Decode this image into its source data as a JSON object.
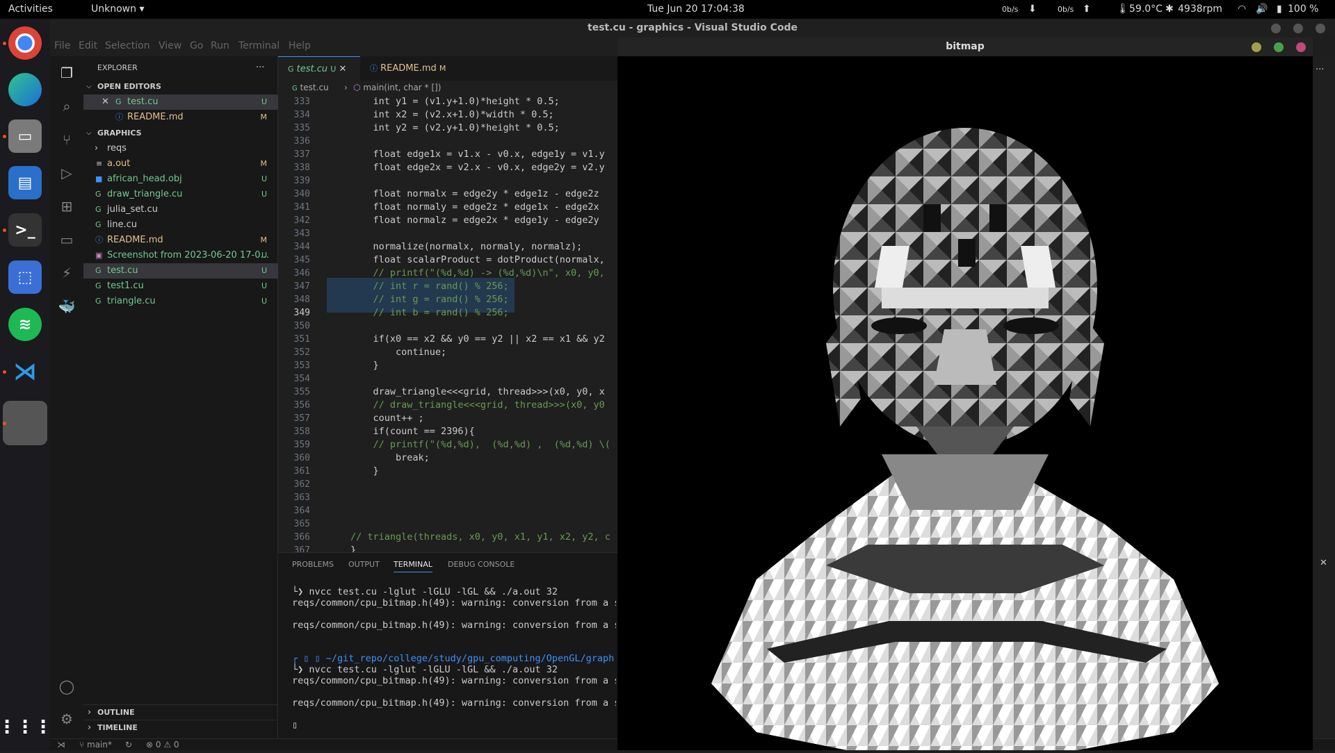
{
  "topbar": {
    "activities": "Activities",
    "app_menu": "Unknown",
    "clock": "Tue Jun 20  17:04:38",
    "net_down": "0b/s",
    "net_up": "0b/s",
    "temp": "59.0°C",
    "fan": "4938rpm",
    "battery": "100 %"
  },
  "vscode": {
    "title": "test.cu - graphics - Visual Studio Code",
    "menu": [
      "File",
      "Edit",
      "Selection",
      "View",
      "Go",
      "Run",
      "Terminal",
      "Help"
    ],
    "explorer": {
      "header": "EXPLORER",
      "open_editors_label": "OPEN EDITORS",
      "open_editors": [
        {
          "name": "test.cu",
          "status": "U"
        },
        {
          "name": "README.md",
          "status": "M"
        }
      ],
      "folder_label": "GRAPHICS",
      "files": [
        {
          "name": "reqs",
          "status": ""
        },
        {
          "name": "a.out",
          "status": "M"
        },
        {
          "name": "african_head.obj",
          "status": "U"
        },
        {
          "name": "draw_triangle.cu",
          "status": "U"
        },
        {
          "name": "julia_set.cu",
          "status": ""
        },
        {
          "name": "line.cu",
          "status": ""
        },
        {
          "name": "README.md",
          "status": "M"
        },
        {
          "name": "Screenshot from 2023-06-20 17-0...",
          "status": "U"
        },
        {
          "name": "test.cu",
          "status": "U"
        },
        {
          "name": "test1.cu",
          "status": "U"
        },
        {
          "name": "triangle.cu",
          "status": "U"
        }
      ],
      "outline_label": "OUTLINE",
      "timeline_label": "TIMELINE"
    },
    "tabs": [
      {
        "label": "test.cu",
        "status": "U"
      },
      {
        "label": "README.md",
        "status": "M"
      }
    ],
    "breadcrumb": {
      "file": "test.cu",
      "symbol": "main(int, char * [])"
    },
    "code_lines": [
      {
        "n": "333",
        "t": "    int y1 = (v1.y+1.0)*height * 0.5;"
      },
      {
        "n": "334",
        "t": "    int x2 = (v2.x+1.0)*width * 0.5;"
      },
      {
        "n": "335",
        "t": "    int y2 = (v2.y+1.0)*height * 0.5;"
      },
      {
        "n": "336",
        "t": ""
      },
      {
        "n": "337",
        "t": "    float edge1x = v1.x - v0.x, edge1y = v1.y"
      },
      {
        "n": "338",
        "t": "    float edge2x = v2.x - v0.x, edge2y = v2.y"
      },
      {
        "n": "339",
        "t": ""
      },
      {
        "n": "340",
        "t": "    float normalx = edge2y * edge1z - edge2z"
      },
      {
        "n": "341",
        "t": "    float normaly = edge2z * edge1x - edge2x"
      },
      {
        "n": "342",
        "t": "    float normalz = edge2x * edge1y - edge2y"
      },
      {
        "n": "343",
        "t": ""
      },
      {
        "n": "344",
        "t": "    normalize(normalx, normaly, normalz);"
      },
      {
        "n": "345",
        "t": "    float scalarProduct = dotProduct(normalx,"
      },
      {
        "n": "346",
        "t": "    // printf(\"(%d,%d) -> (%d,%d)\\n\", x0, y0,"
      },
      {
        "n": "347",
        "t": "    // int r = rand() % 256;"
      },
      {
        "n": "348",
        "t": "    // int g = rand() % 256;"
      },
      {
        "n": "349",
        "t": "    // int b = rand() % 256;"
      },
      {
        "n": "350",
        "t": ""
      },
      {
        "n": "351",
        "t": "    if(x0 == x2 && y0 == y2 || x2 == x1 && y2"
      },
      {
        "n": "352",
        "t": "        continue;"
      },
      {
        "n": "353",
        "t": "    }"
      },
      {
        "n": "354",
        "t": ""
      },
      {
        "n": "355",
        "t": "    draw_triangle<<<grid, thread>>>(x0, y0, x"
      },
      {
        "n": "356",
        "t": "    // draw_triangle<<<grid, thread>>>(x0, y0"
      },
      {
        "n": "357",
        "t": "    count++ ;"
      },
      {
        "n": "358",
        "t": "    if(count == 2396){"
      },
      {
        "n": "359",
        "t": "    // printf(\"(%d,%d),  (%d,%d) ,  (%d,%d) \\("
      },
      {
        "n": "360",
        "t": "        break;"
      },
      {
        "n": "361",
        "t": "    }"
      },
      {
        "n": "362",
        "t": ""
      },
      {
        "n": "363",
        "t": ""
      },
      {
        "n": "364",
        "t": ""
      },
      {
        "n": "365",
        "t": ""
      },
      {
        "n": "366",
        "t": "// triangle(threads, x0, y0, x1, y1, x2, y2, c"
      },
      {
        "n": "367",
        "t": "}"
      }
    ],
    "panel_tabs": [
      "PROBLEMS",
      "OUTPUT",
      "TERMINAL",
      "DEBUG CONSOLE"
    ],
    "terminal_lines": [
      "└❯ nvcc test.cu -lglut -lGLU -lGL && ./a.out 32",
      "reqs/common/cpu_bitmap.h(49): warning: conversion from a s",
      "",
      "reqs/common/cpu_bitmap.h(49): warning: conversion from a s",
      "",
      "",
      "┌ ▯ ▯ ~/git_repo/college/study/gpu_computing/OpenGL/graph",
      "└❯ nvcc test.cu -lglut -lGLU -lGL && ./a.out 32",
      "reqs/common/cpu_bitmap.h(49): warning: conversion from a s",
      "",
      "reqs/common/cpu_bitmap.h(49): warning: conversion from a s",
      "",
      "▯"
    ],
    "status": {
      "branch": "main*",
      "errors": "0",
      "warnings": "0"
    }
  },
  "bitmap_window": {
    "title": "bitmap"
  },
  "colors": {
    "accent": "#3794ff",
    "untracked": "#73c991",
    "modified": "#e2c08d"
  }
}
